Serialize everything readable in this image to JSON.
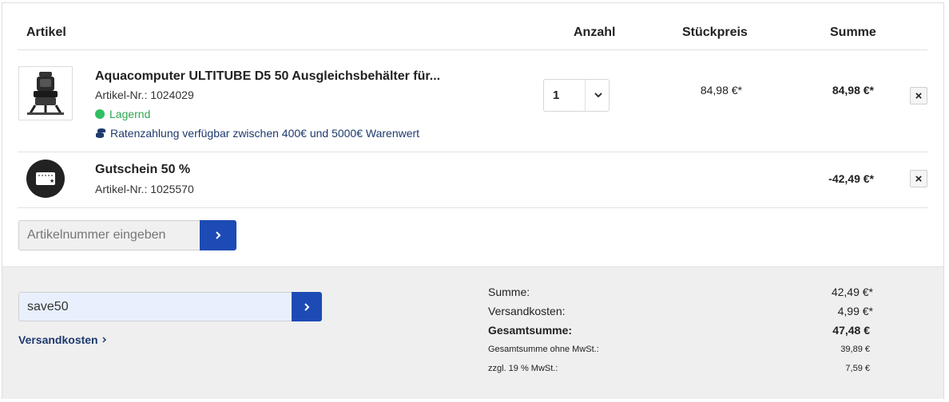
{
  "table_header": {
    "article": "Artikel",
    "quantity": "Anzahl",
    "unit_price": "Stückpreis",
    "sum": "Summe"
  },
  "items": [
    {
      "name": "Aquacomputer ULTITUBE D5 50 Ausgleichsbehälter für...",
      "article_no": "Artikel-Nr.: 1024029",
      "stock": "Lagernd",
      "installment": "Ratenzahlung verfügbar zwischen 400€ und 5000€ Warenwert",
      "quantity": "1",
      "unit_price": "84,98 €*",
      "total": "84,98 €*",
      "remove": "×"
    },
    {
      "name": "Gutschein 50 %",
      "article_no": "Artikel-Nr.: 1025570",
      "total": "-42,49 €*",
      "remove": "×"
    }
  ],
  "add_article": {
    "placeholder": "Artikelnummer eingeben"
  },
  "voucher": {
    "value": "save50"
  },
  "shipping_link": "Versandkosten",
  "totals": {
    "sum_label": "Summe:",
    "sum_value": "42,49 €*",
    "shipping_label": "Versandkosten:",
    "shipping_value": "4,99 €*",
    "grand_label": "Gesamtsumme:",
    "grand_value": "47,48 €",
    "net_label": "Gesamtsumme ohne MwSt.:",
    "net_value": "39,89 €",
    "vat_label": "zzgl. 19 % MwSt.:",
    "vat_value": "7,59 €"
  },
  "colors": {
    "accent": "#1d4bb5",
    "in_stock": "#2fbf63",
    "footer_bg": "#efefef",
    "link": "#1e3a6e"
  }
}
